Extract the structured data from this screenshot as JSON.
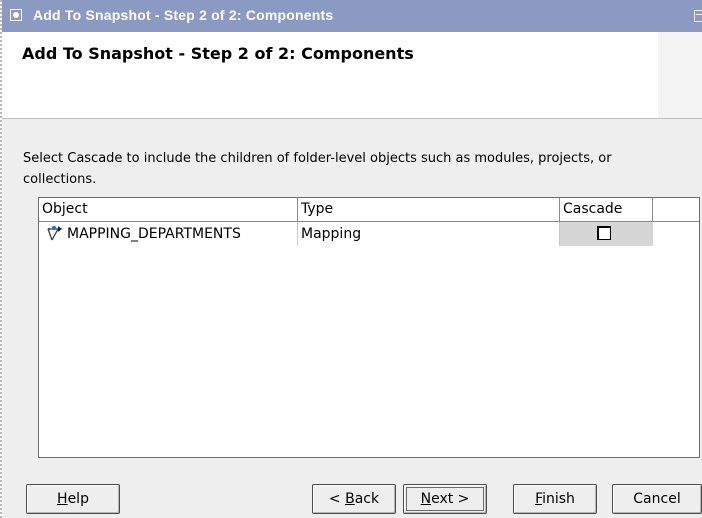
{
  "window": {
    "title": "Add To Snapshot - Step 2 of 2: Components"
  },
  "dialog": {
    "heading": "Add To Snapshot - Step 2 of 2: Components",
    "instructions": "Select Cascade to include the children of folder-level objects such as modules, projects, or collections."
  },
  "table": {
    "columns": [
      "Object",
      "Type",
      "Cascade"
    ],
    "rows": [
      {
        "object": "MAPPING_DEPARTMENTS",
        "type": "Mapping",
        "cascade": false,
        "icon": "mapping-icon"
      }
    ]
  },
  "buttons": {
    "help": {
      "mnemonic": "H",
      "rest": "elp"
    },
    "back": {
      "prefix": "< ",
      "mnemonic": "B",
      "rest": "ack"
    },
    "next": {
      "mnemonic": "N",
      "rest": "ext >"
    },
    "finish": {
      "mnemonic": "F",
      "rest": "inish"
    },
    "cancel": {
      "label": "Cancel"
    }
  },
  "colors": {
    "titlebar": "#8a9ac2",
    "body": "#eeeeee",
    "cascade_cell": "#d6d6d6"
  }
}
